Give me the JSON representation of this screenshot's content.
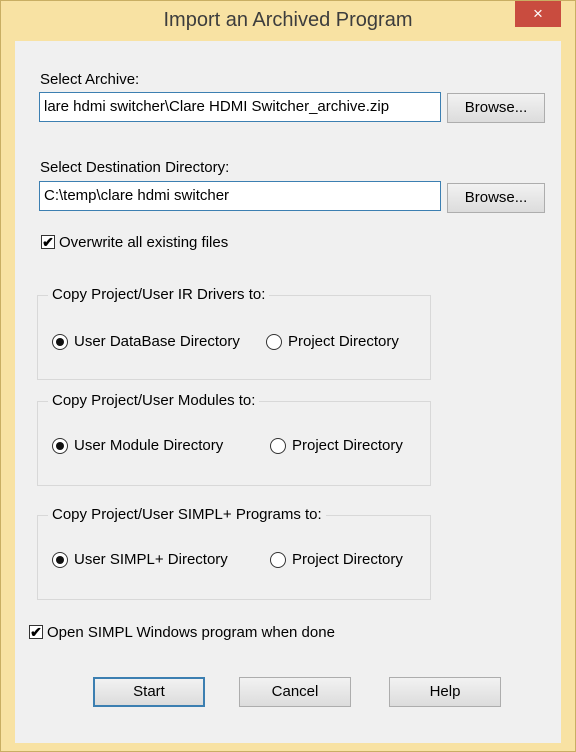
{
  "window": {
    "title": "Import an Archived Program",
    "close_glyph": "×"
  },
  "archive": {
    "label": "Select Archive:",
    "value": "lare hdmi switcher\\Clare HDMI Switcher_archive.zip",
    "browse_label": "Browse..."
  },
  "destination": {
    "label": "Select Destination Directory:",
    "value": "C:\\temp\\clare hdmi switcher",
    "browse_label": "Browse..."
  },
  "overwrite": {
    "label": "Overwrite all existing files",
    "checked": true
  },
  "ir_drivers": {
    "legend": "Copy Project/User IR Drivers to:",
    "option1": "User DataBase Directory",
    "option2": "Project Directory",
    "selected": "option1"
  },
  "modules": {
    "legend": "Copy Project/User Modules to:",
    "option1": "User Module Directory",
    "option2": "Project Directory",
    "selected": "option1"
  },
  "simpl_plus": {
    "legend": "Copy Project/User SIMPL+ Programs to:",
    "option1": "User SIMPL+ Directory",
    "option2": "Project Directory",
    "selected": "option1"
  },
  "open_when_done": {
    "label": "Open SIMPL Windows program when done",
    "checked": true
  },
  "buttons": {
    "start": "Start",
    "cancel": "Cancel",
    "help": "Help"
  },
  "check_glyph": "✔",
  "icons": {
    "close": "close-icon",
    "check": "checkmark-icon",
    "radio": "radio-dot-icon"
  }
}
